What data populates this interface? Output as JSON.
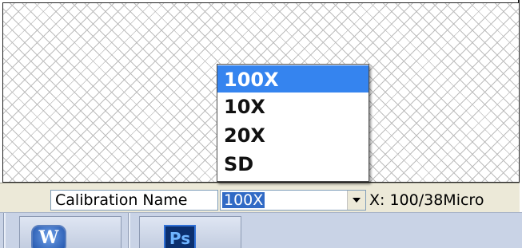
{
  "statusbar": {
    "calibration_label": "Calibration Name",
    "calibration_selected": "100X",
    "x_readout": "X: 100/38Micro"
  },
  "dropdown": {
    "options": [
      "100X",
      "10X",
      "20X",
      "SD"
    ],
    "selected_index": 0
  },
  "taskbar": {
    "apps": [
      {
        "name": "word-icon",
        "glyph": "W"
      },
      {
        "name": "photoshop-icon",
        "glyph": "Ps"
      }
    ]
  },
  "colors": {
    "selection": "#3584ef",
    "combo_selection": "#316ac5",
    "statusbar_bg": "#ece9d8",
    "taskbar_bg": "#c9d3e6"
  }
}
